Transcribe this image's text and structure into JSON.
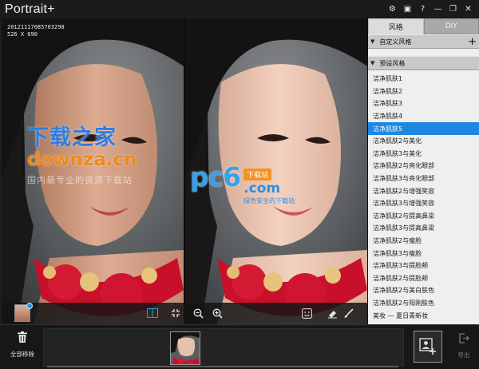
{
  "app": {
    "title": "Portrait+"
  },
  "window_controls": {
    "settings": "⚙",
    "chat": "▣",
    "help": "?",
    "minimize": "—",
    "restore": "❐",
    "close": "✕"
  },
  "photo": {
    "meta_line1": "20121117085703298",
    "meta_line2": "526 X 690"
  },
  "watermarks": {
    "left_big": "下载之家",
    "left_domain": "downza.cn",
    "left_tagline": "国内最专业的资源下载站",
    "right_logo": "pc6",
    "right_tag": "下载站",
    "right_domain": ".com",
    "right_tagline": "绿色安全的下载站"
  },
  "panel": {
    "tabs": [
      {
        "label": "风格"
      },
      {
        "label": "DIY"
      }
    ],
    "custom_section": "自定义风格",
    "preset_section": "预设风格",
    "styles": [
      "洁净肌肤1",
      "洁净肌肤2",
      "洁净肌肤3",
      "洁净肌肤4",
      "洁净肌肤5",
      "洁净肌肤2与美化",
      "洁净肌肤3与美化",
      "洁净肌肤2与亮化眼部",
      "洁净肌肤3与亮化眼部",
      "洁净肌肤2与增强笑容",
      "洁净肌肤3与增强笑容",
      "洁净肌肤2与提高鼻梁",
      "洁净肌肤3与提高鼻梁",
      "洁净肌肤2与瘦脸",
      "洁净肌肤3与瘦脸",
      "洁净肌肤3与提脸颊",
      "洁净肌肤2与提脸颊",
      "洁净肌肤2与美白肤色",
      "洁净肌肤2与阳刚肤色",
      "美妆 — 夏日青新妆"
    ],
    "selected_style": "洁净肌肤5"
  },
  "bottom": {
    "clear_label": "全部移除",
    "export_label": "导出"
  },
  "colors": {
    "accent": "#1e87e0",
    "panel_bg": "#efefef"
  }
}
